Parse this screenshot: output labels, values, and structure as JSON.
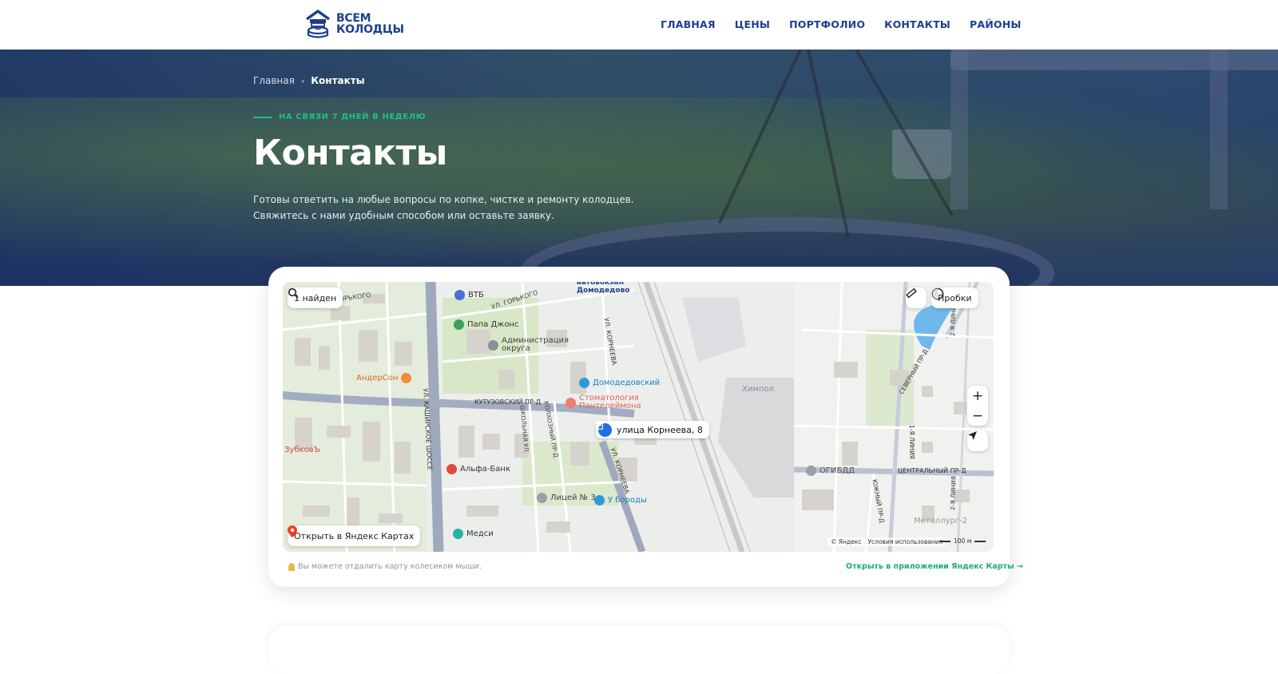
{
  "header": {
    "logo_line1": "ВСЕМ",
    "logo_line2": "КОЛОДЦЫ",
    "nav": [
      "ГЛАВНАЯ",
      "ЦЕНЫ",
      "ПОРТФОЛИО",
      "КОНТАКТЫ",
      "РАЙОНЫ"
    ]
  },
  "hero": {
    "breadcrumb_home": "Главная",
    "breadcrumb_sep": "›",
    "breadcrumb_current": "Контакты",
    "eyebrow": "НА СВЯЗИ 7 ДНЕЙ В НЕДЕЛЮ",
    "title": "Контакты",
    "text": "Готовы ответить на любые вопросы по копке, чистке и ремонту колодцев. Свяжитесь с нами удобным способом или оставьте заявку."
  },
  "map": {
    "found_label": "1 найден",
    "traffic_label": "Пробки",
    "open_label": "Открыть в Яндекс Картах",
    "address": "улица Корнеева, 8",
    "copyright": "© Яндекс",
    "terms": "Условия использования",
    "scale": "100 м",
    "zoom_in": "+",
    "zoom_out": "−",
    "labels": {
      "vtb": "ВТБ",
      "papa": "Папа Джонс",
      "admin": "Администрация\nокруга",
      "andersen": "АндерСон",
      "domodedovsky": "Домодедовский",
      "stoma": "Стоматология\nПантелеймона",
      "zubkov": "ЗубковЪ",
      "alfa": "Альфа-Банк",
      "licey": "Лицей № 3",
      "uborody": "У бороды",
      "medsi": "Медси",
      "gibdd": "ОГИБДД",
      "himpol": "Химпол",
      "metallurg": "Металлург-2",
      "avtovokzal": "автовокзал\nДомодедово",
      "kutuzov": "КУТУЗОВСКИЙ ПР-Д",
      "kashirskoe": "УЛ. КАШИРСКОЕ ШОССЕ",
      "korneeva": "УЛ. КОРНЕЕВА",
      "central": "ЦЕНТРАЛЬНЫЙ ПР-Д",
      "gorkogo": "УЛ. ГОРЬКОГО",
      "severny": "СЕВЕРНЫЙ ПР-Д",
      "yuzhny": "ЮЖНЫЙ ПР-Д",
      "liniya1": "1-Я ЛИНИЯ",
      "liniya2": "2-Я ЛИНИЯ",
      "shkolnaya": "ШКОЛЬНАЯ УЛ.",
      "kolhozny": "КОЛХОЗНЫЙ ПР-Д"
    }
  },
  "footer_card": {
    "hint": "Вы можете отдалить карту колесиком мыши.",
    "app_link": "Открыть в приложении Яндекс Карты →"
  },
  "colors": {
    "brand": "#1e3f8f",
    "accent": "#1fbf83",
    "link_green": "#1fae74"
  }
}
